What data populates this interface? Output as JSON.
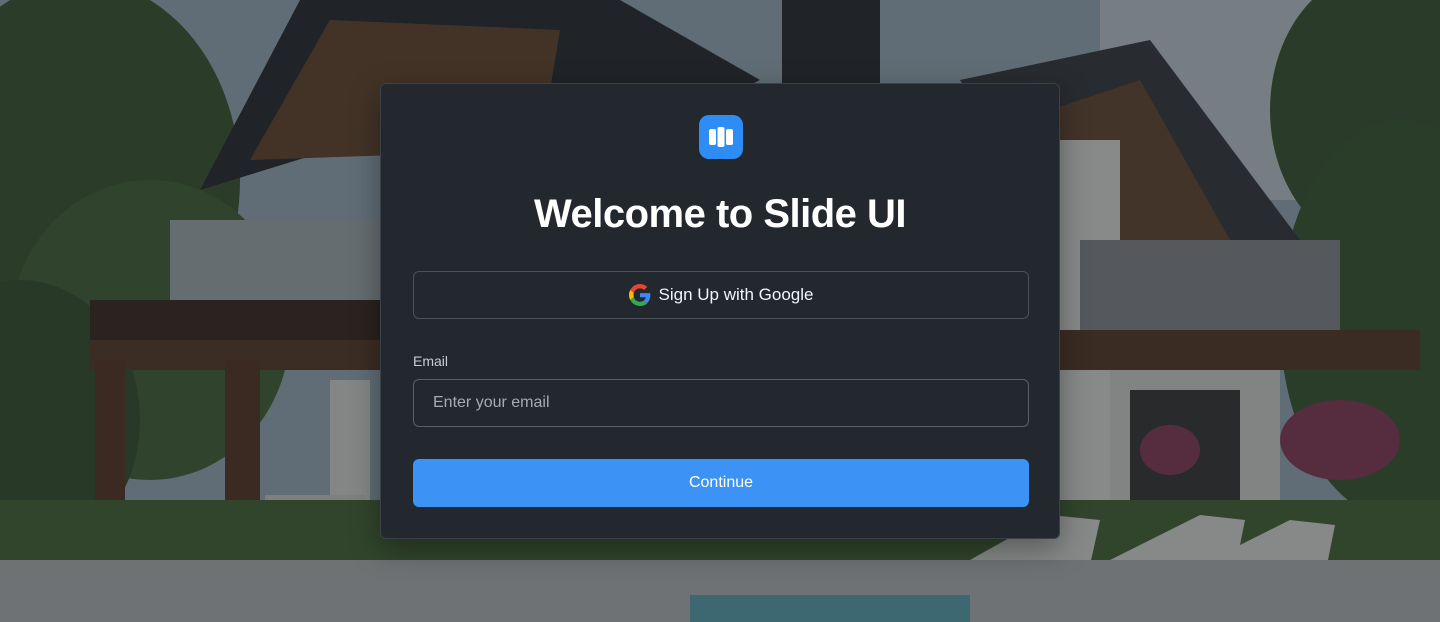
{
  "background": {
    "icon": "house-pool-photo"
  },
  "modal": {
    "logo_icon": "slide-ui-logo-icon",
    "title": "Welcome to Slide UI",
    "google_button": {
      "icon": "google-g-icon",
      "label": "Sign Up with Google"
    },
    "email": {
      "label": "Email",
      "placeholder": "Enter your email",
      "value": ""
    },
    "continue_button": {
      "label": "Continue"
    }
  },
  "colors": {
    "accent": "#3d93f5",
    "logo": "#2f8cf4",
    "card_bg": "#22282e",
    "text": "#ffffff"
  }
}
